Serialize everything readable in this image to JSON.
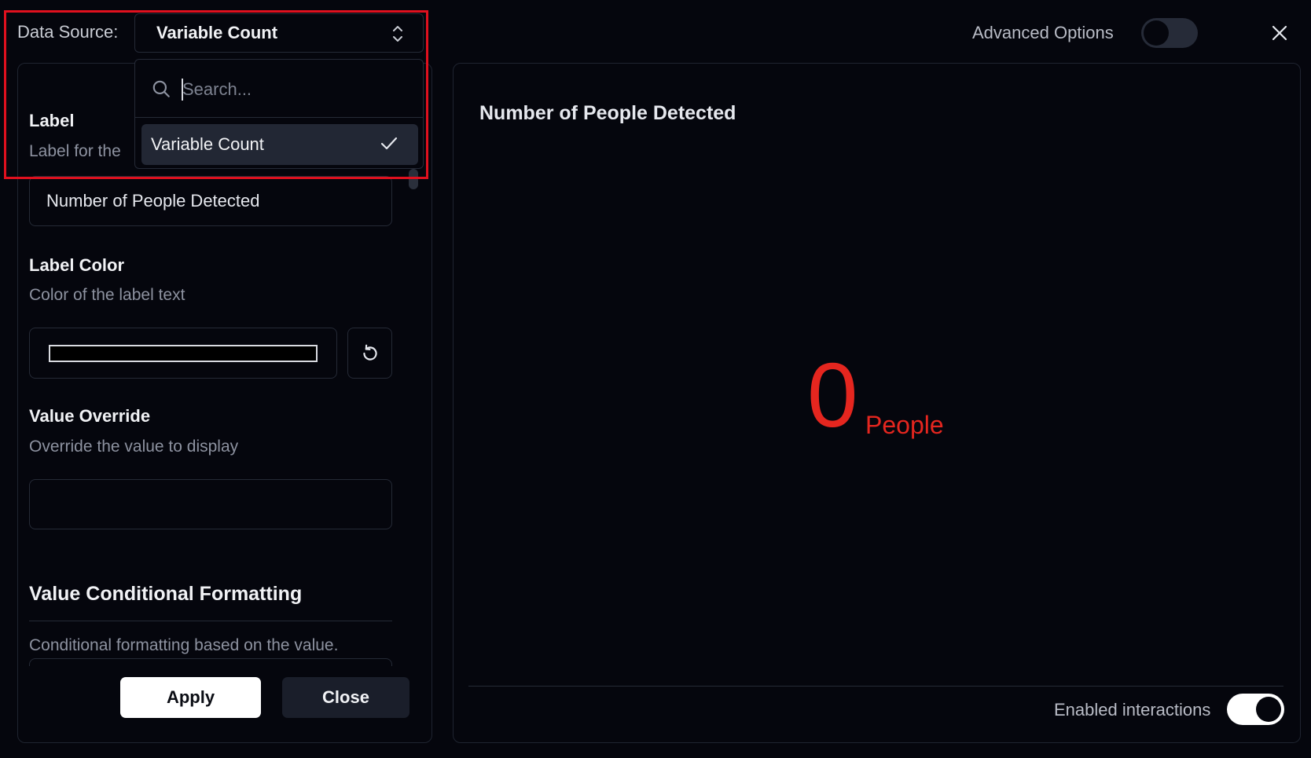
{
  "data_source": {
    "label": "Data Source:",
    "selected": "Variable Count"
  },
  "dropdown": {
    "search_placeholder": "Search...",
    "options": [
      {
        "label": "Variable Count",
        "selected": true
      }
    ]
  },
  "header": {
    "advanced_options_label": "Advanced Options",
    "advanced_options_enabled": false
  },
  "form": {
    "label_title": "Label",
    "label_desc": "Label for the",
    "label_value": "Number of People Detected",
    "label_color_title": "Label Color",
    "label_color_desc": "Color of the label text",
    "label_color_value": "#000000",
    "value_override_title": "Value Override",
    "value_override_desc": "Override the value to display",
    "value_override_value": "",
    "conditional_title": "Value Conditional Formatting",
    "conditional_desc": "Conditional formatting based on the value."
  },
  "buttons": {
    "apply": "Apply",
    "close": "Close"
  },
  "preview": {
    "title": "Number of People Detected",
    "value": "0",
    "unit": "People",
    "value_color": "#e5261f",
    "enabled_interactions_label": "Enabled interactions",
    "enabled_interactions_on": true
  },
  "colors": {
    "background": "#05060d",
    "border": "#252a36",
    "highlight": "#e0101e"
  }
}
